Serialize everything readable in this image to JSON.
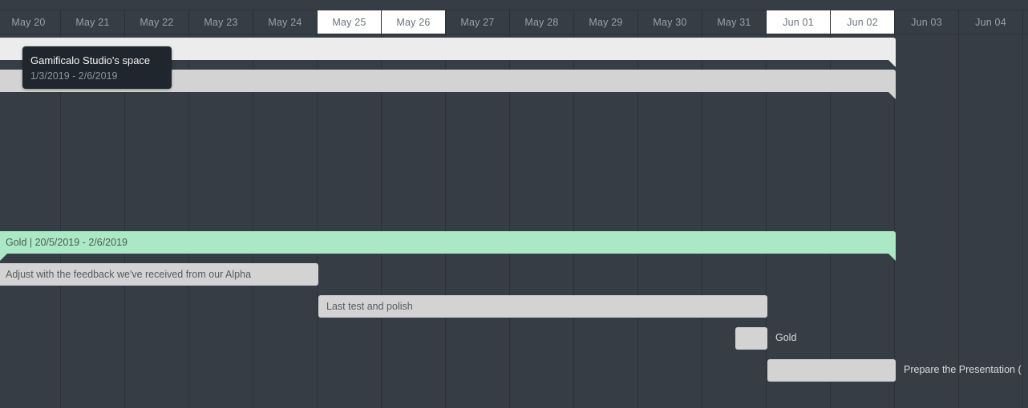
{
  "timeline": {
    "days": [
      {
        "label": "May 20",
        "weekend": false
      },
      {
        "label": "May 21",
        "weekend": false
      },
      {
        "label": "May 22",
        "weekend": false
      },
      {
        "label": "May 23",
        "weekend": false
      },
      {
        "label": "May 24",
        "weekend": false
      },
      {
        "label": "May 25",
        "weekend": true
      },
      {
        "label": "May 26",
        "weekend": true
      },
      {
        "label": "May 27",
        "weekend": false
      },
      {
        "label": "May 28",
        "weekend": false
      },
      {
        "label": "May 29",
        "weekend": false
      },
      {
        "label": "May 30",
        "weekend": false
      },
      {
        "label": "May 31",
        "weekend": false
      },
      {
        "label": "Jun 01",
        "weekend": true
      },
      {
        "label": "Jun 02",
        "weekend": true
      },
      {
        "label": "Jun 03",
        "weekend": false
      },
      {
        "label": "Jun 04",
        "weekend": false
      }
    ]
  },
  "tooltip": {
    "title": "Gamificalo Studio's space",
    "dates": "1/3/2019 - 2/6/2019"
  },
  "tasks": {
    "gold_phase": {
      "label": "Gold | 20/5/2019 - 2/6/2019",
      "color": "#abe9c6"
    },
    "adjust_feedback": {
      "label": "Adjust with the feedback we've received from our Alpha"
    },
    "last_test": {
      "label": "Last test and polish"
    },
    "gold_milestone": {
      "label": "Gold"
    },
    "prepare_presentation": {
      "label": "Prepare the Presentation ("
    }
  },
  "colors": {
    "background": "#363d45",
    "bar_light": "#ececec",
    "bar_grey": "#d3d3d3",
    "bar_green": "#abe9c6",
    "tooltip_bg": "#20262d"
  }
}
